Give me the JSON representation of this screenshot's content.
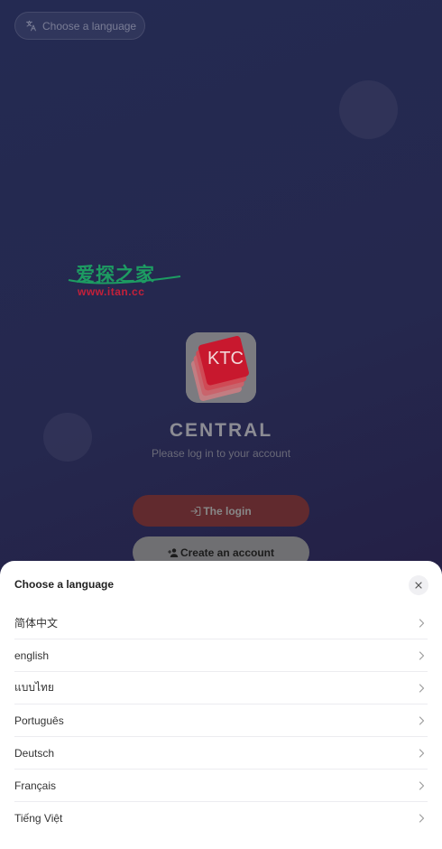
{
  "header": {
    "language_button_label": "Choose a language",
    "language_icon": "translate-icon"
  },
  "watermark": {
    "brand": "爱探之家",
    "url": "www.itan.cc"
  },
  "app": {
    "logo_text": "KTC",
    "title": "CENTRAL",
    "subtitle": "Please log in to your account"
  },
  "actions": {
    "login_label": "The login",
    "login_icon": "login-icon",
    "create_label": "Create an account",
    "create_icon": "add-user-icon"
  },
  "language_sheet": {
    "title": "Choose a language",
    "close_icon": "close-icon",
    "languages": [
      {
        "label": "简体中文"
      },
      {
        "label": "english"
      },
      {
        "label": "แบบไทย"
      },
      {
        "label": "Português"
      },
      {
        "label": "Deutsch"
      },
      {
        "label": "Français"
      },
      {
        "label": "Tiếng Việt"
      }
    ]
  },
  "colors": {
    "background_top": "#242a52",
    "background_bottom": "#281d43",
    "login_button": "#612a2e",
    "create_button": "#6f6f72",
    "logo_red": "#c8182e",
    "sheet_background": "#ffffff"
  }
}
